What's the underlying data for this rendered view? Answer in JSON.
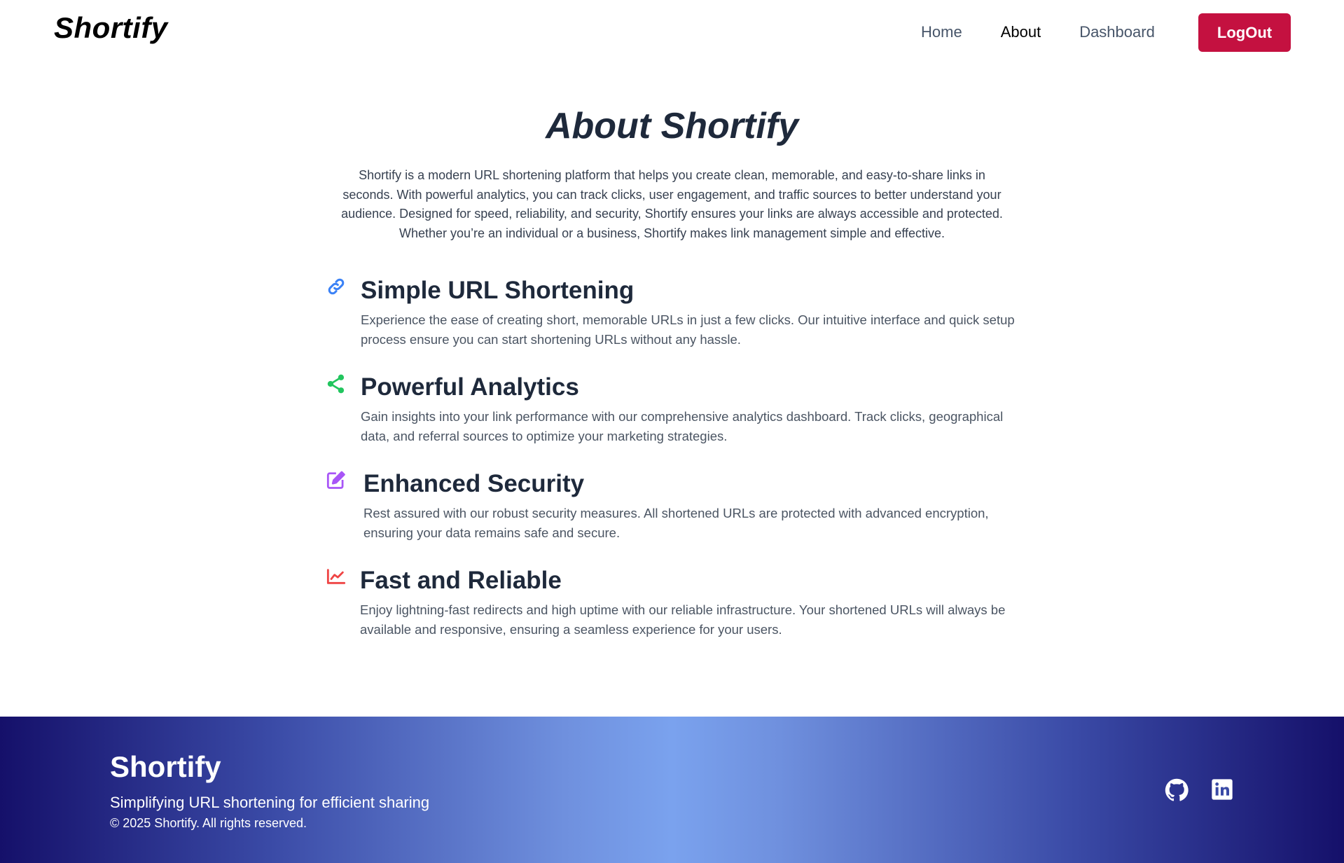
{
  "navbar": {
    "brand": "Shortify",
    "links": [
      "Home",
      "About",
      "Dashboard"
    ],
    "logout_label": "LogOut"
  },
  "main": {
    "title": "About Shortify",
    "intro": "Shortify is a modern URL shortening platform that helps you create clean, memorable, and easy-to-share links in seconds. With powerful analytics, you can track clicks, user engagement, and traffic sources to better understand your audience. Designed for speed, reliability, and security, Shortify ensures your links are always accessible and protected. Whether you’re an individual or a business, Shortify makes link management simple and effective.",
    "features": [
      {
        "icon": "link-icon",
        "color": "#3b82f6",
        "title": "Simple URL Shortening",
        "desc": "Experience the ease of creating short, memorable URLs in just a few clicks. Our intuitive interface and quick setup process ensure you can start shortening URLs without any hassle."
      },
      {
        "icon": "share-icon",
        "color": "#22c55e",
        "title": "Powerful Analytics",
        "desc": "Gain insights into your link performance with our comprehensive analytics dashboard. Track clicks, geographical data, and referral sources to optimize your marketing strategies."
      },
      {
        "icon": "edit-icon",
        "color": "#a855f7",
        "title": "Enhanced Security",
        "desc": "Rest assured with our robust security measures. All shortened URLs are protected with advanced encryption, ensuring your data remains safe and secure."
      },
      {
        "icon": "chart-line-icon",
        "color": "#ef4444",
        "title": "Fast and Reliable",
        "desc": "Enjoy lightning-fast redirects and high uptime with our reliable infrastructure. Your shortened URLs will always be available and responsive, ensuring a seamless experience for your users."
      }
    ]
  },
  "footer": {
    "brand": "Shortify",
    "tagline": "Simplifying URL shortening for efficient sharing",
    "copyright": "© 2025 Shortify. All rights reserved.",
    "social": [
      "github-icon",
      "linkedin-icon"
    ]
  },
  "colors": {
    "logout": "#c41140",
    "footer_edge": "#15106a",
    "footer_center": "#7aa2ee"
  }
}
